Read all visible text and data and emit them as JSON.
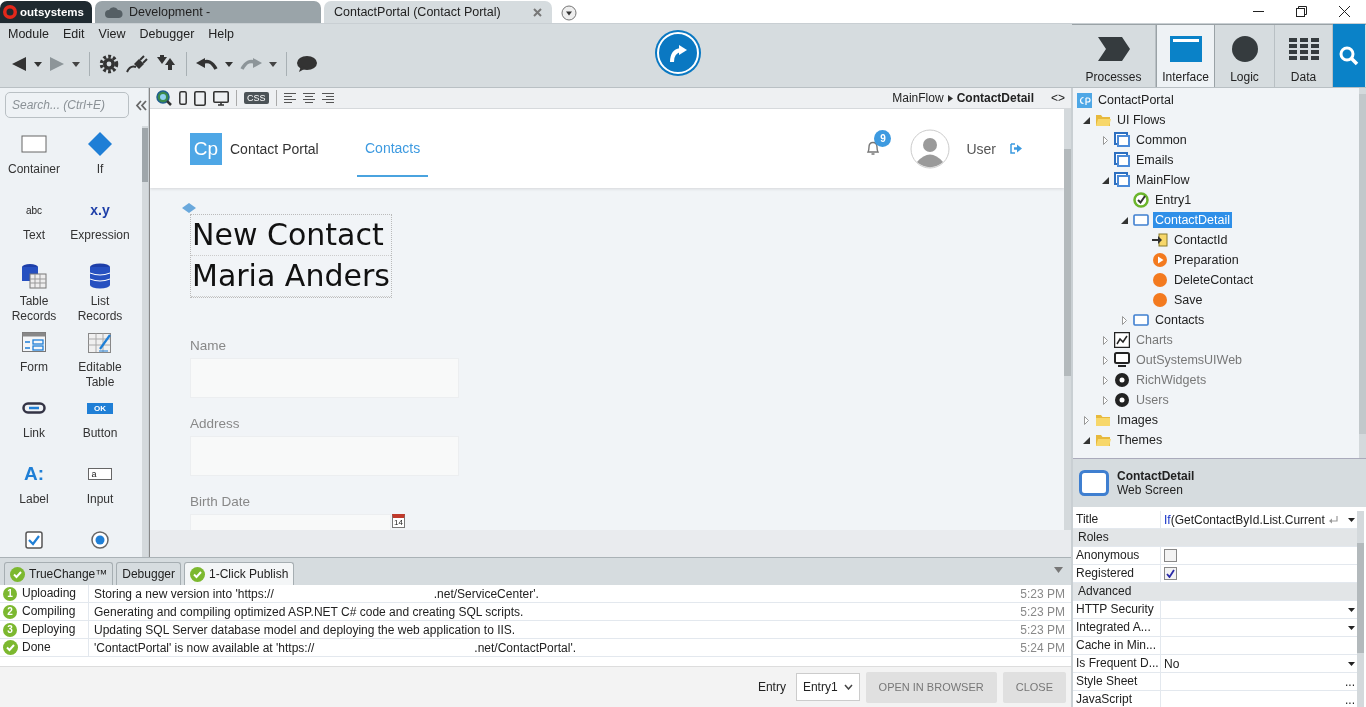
{
  "title_bar": {
    "tabs": [
      {
        "kind": "brand",
        "label": "outsystems",
        "selected": false
      },
      {
        "kind": "environment",
        "label": "Development -",
        "selected": false
      },
      {
        "kind": "module",
        "label": "ContactPortal (Contact Portal)",
        "selected": true
      }
    ]
  },
  "menu": [
    "Module",
    "Edit",
    "View",
    "Debugger",
    "Help"
  ],
  "area_tabs": [
    {
      "kind": "processes",
      "label": "Processes",
      "selected": false
    },
    {
      "kind": "interface",
      "label": "Interface",
      "selected": true
    },
    {
      "kind": "logic",
      "label": "Logic",
      "selected": false
    },
    {
      "kind": "data",
      "label": "Data",
      "selected": false
    }
  ],
  "toolbox": {
    "search": {
      "placeholder": "Search... (Ctrl+E)"
    },
    "widget_rows": [
      {
        "widgets": [
          {
            "kind": "container",
            "label": "Container"
          },
          {
            "kind": "if",
            "label": "If"
          }
        ]
      },
      {
        "widgets": [
          {
            "kind": "text",
            "label": "Text",
            "glyph": "abc"
          },
          {
            "kind": "expression",
            "label": "Expression",
            "glyph": "x.y"
          }
        ]
      },
      {
        "widgets": [
          {
            "kind": "table-records",
            "label": "Table Records"
          },
          {
            "kind": "list-records",
            "label": "List Records"
          }
        ]
      },
      {
        "widgets": [
          {
            "kind": "form",
            "label": "Form"
          },
          {
            "kind": "editable-table",
            "label": "Editable Table"
          }
        ]
      },
      {
        "widgets": [
          {
            "kind": "link",
            "label": "Link"
          },
          {
            "kind": "button",
            "label": "Button",
            "glyph": "OK"
          }
        ]
      },
      {
        "widgets": [
          {
            "kind": "label",
            "label": "Label",
            "glyph": "A:"
          },
          {
            "kind": "input",
            "label": "Input",
            "glyph": "a"
          }
        ]
      },
      {
        "widgets": [
          {
            "kind": "checkbox"
          },
          {
            "kind": "radio-button"
          }
        ]
      }
    ]
  },
  "canvas": {
    "toolbar": {
      "css_label": "CSS",
      "breadcrumb": [
        "MainFlow",
        "ContactDetail"
      ],
      "code_toggle": "<>"
    },
    "app": {
      "logo": "Cp",
      "name": "Contact Portal",
      "nav": [
        {
          "label": "Contacts",
          "selected": true
        }
      ],
      "notifications": "9",
      "user": "User"
    },
    "title_lines": [
      "New Contact",
      "Maria Anders"
    ],
    "fields": [
      {
        "kind": "text",
        "label": "Name"
      },
      {
        "kind": "text",
        "label": "Address"
      },
      {
        "kind": "date",
        "label": "Birth Date",
        "icon_text": "14"
      }
    ]
  },
  "tree": {
    "root": "ContactPortal",
    "items": [
      {
        "kind": "folder",
        "label": "UI Flows",
        "expanded": true,
        "selected": false,
        "dimmed": false,
        "children": [
          {
            "kind": "flow",
            "label": "Common",
            "expanded": false,
            "selected": false,
            "dimmed": false
          },
          {
            "kind": "flow",
            "label": "Emails",
            "selected": false,
            "dimmed": false
          },
          {
            "kind": "flow",
            "label": "MainFlow",
            "expanded": true,
            "selected": false,
            "dimmed": false,
            "children": [
              {
                "kind": "entry",
                "label": "Entry1",
                "selected": false,
                "dimmed": false
              },
              {
                "kind": "screen",
                "label": "ContactDetail",
                "expanded": true,
                "selected": true,
                "dimmed": false,
                "children": [
                  {
                    "kind": "input",
                    "label": "ContactId",
                    "selected": false,
                    "dimmed": false
                  },
                  {
                    "kind": "preparation",
                    "label": "Preparation",
                    "selected": false,
                    "dimmed": false
                  },
                  {
                    "kind": "action",
                    "label": "DeleteContact",
                    "selected": false,
                    "dimmed": false
                  },
                  {
                    "kind": "action",
                    "label": "Save",
                    "selected": false,
                    "dimmed": false
                  }
                ]
              },
              {
                "kind": "screen",
                "label": "Contacts",
                "expanded": false,
                "selected": false,
                "dimmed": false
              }
            ]
          },
          {
            "kind": "chart",
            "label": "Charts",
            "expanded": false,
            "selected": false,
            "dimmed": true
          },
          {
            "kind": "module",
            "label": "OutSystemsUIWeb",
            "expanded": false,
            "selected": false,
            "dimmed": true
          },
          {
            "kind": "library",
            "label": "RichWidgets",
            "expanded": false,
            "selected": false,
            "dimmed": true
          },
          {
            "kind": "library",
            "label": "Users",
            "expanded": false,
            "selected": false,
            "dimmed": true
          }
        ]
      },
      {
        "kind": "folder",
        "label": "Images",
        "expanded": false,
        "selected": false,
        "dimmed": false
      },
      {
        "kind": "folder",
        "label": "Themes",
        "expanded": true,
        "selected": false,
        "dimmed": false
      }
    ]
  },
  "properties": {
    "name": "ContactDetail",
    "type": "Web Screen",
    "rows": [
      {
        "kind": "expression",
        "label": "Title",
        "keyword": "If",
        "value": "(GetContactById.List.Current"
      },
      {
        "kind": "section",
        "label": "Roles"
      },
      {
        "kind": "checkbox",
        "label": "Anonymous",
        "checked": false
      },
      {
        "kind": "checkbox",
        "label": "Registered",
        "checked": true
      },
      {
        "kind": "section",
        "label": "Advanced"
      },
      {
        "kind": "dropdown",
        "label": "HTTP Security"
      },
      {
        "kind": "dropdown",
        "label": "Integrated A..."
      },
      {
        "kind": "text",
        "label": "Cache in Min..."
      },
      {
        "kind": "dropdown",
        "label": "Is Frequent D...",
        "value": "No"
      },
      {
        "kind": "browse",
        "label": "Style Sheet",
        "button": "..."
      },
      {
        "kind": "browse",
        "label": "JavaScript",
        "button": "..."
      }
    ]
  },
  "output": {
    "tabs": [
      {
        "kind": "checked",
        "label": "TrueChange™",
        "selected": false
      },
      {
        "kind": "plain",
        "label": "Debugger",
        "selected": false
      },
      {
        "kind": "checked",
        "label": "1-Click Publish",
        "selected": true
      }
    ],
    "rows": [
      {
        "kind": "numbered",
        "step": "1",
        "stage": "Uploading",
        "message": "Storing a new version into 'https://                                                .net/ServiceCenter'.",
        "time": "5:23 PM"
      },
      {
        "kind": "numbered",
        "step": "2",
        "stage": "Compiling",
        "message": "Generating and compiling optimized ASP.NET C# code and creating SQL scripts.",
        "time": "5:23 PM"
      },
      {
        "kind": "numbered",
        "step": "3",
        "stage": "Deploying",
        "message": "Updating SQL Server database model and deploying the web application to IIS.",
        "time": "5:23 PM"
      },
      {
        "kind": "done",
        "stage": "Done",
        "message": "'ContactPortal' is now available at 'https://                                                .net/ContactPortal'.",
        "time": "5:24 PM"
      }
    ],
    "entry_label": "Entry",
    "entry_value": "Entry1",
    "buttons": [
      "OPEN IN BROWSER",
      "CLOSE"
    ]
  }
}
